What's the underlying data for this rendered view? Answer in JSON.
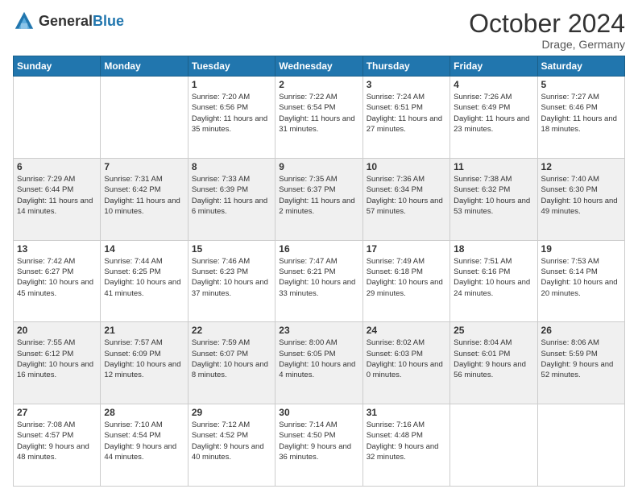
{
  "header": {
    "logo_general": "General",
    "logo_blue": "Blue",
    "month_title": "October 2024",
    "location": "Drage, Germany"
  },
  "days_of_week": [
    "Sunday",
    "Monday",
    "Tuesday",
    "Wednesday",
    "Thursday",
    "Friday",
    "Saturday"
  ],
  "weeks": [
    [
      {
        "day": "",
        "empty": true
      },
      {
        "day": "",
        "empty": true
      },
      {
        "day": "1",
        "sunrise": "Sunrise: 7:20 AM",
        "sunset": "Sunset: 6:56 PM",
        "daylight": "Daylight: 11 hours and 35 minutes."
      },
      {
        "day": "2",
        "sunrise": "Sunrise: 7:22 AM",
        "sunset": "Sunset: 6:54 PM",
        "daylight": "Daylight: 11 hours and 31 minutes."
      },
      {
        "day": "3",
        "sunrise": "Sunrise: 7:24 AM",
        "sunset": "Sunset: 6:51 PM",
        "daylight": "Daylight: 11 hours and 27 minutes."
      },
      {
        "day": "4",
        "sunrise": "Sunrise: 7:26 AM",
        "sunset": "Sunset: 6:49 PM",
        "daylight": "Daylight: 11 hours and 23 minutes."
      },
      {
        "day": "5",
        "sunrise": "Sunrise: 7:27 AM",
        "sunset": "Sunset: 6:46 PM",
        "daylight": "Daylight: 11 hours and 18 minutes."
      }
    ],
    [
      {
        "day": "6",
        "sunrise": "Sunrise: 7:29 AM",
        "sunset": "Sunset: 6:44 PM",
        "daylight": "Daylight: 11 hours and 14 minutes."
      },
      {
        "day": "7",
        "sunrise": "Sunrise: 7:31 AM",
        "sunset": "Sunset: 6:42 PM",
        "daylight": "Daylight: 11 hours and 10 minutes."
      },
      {
        "day": "8",
        "sunrise": "Sunrise: 7:33 AM",
        "sunset": "Sunset: 6:39 PM",
        "daylight": "Daylight: 11 hours and 6 minutes."
      },
      {
        "day": "9",
        "sunrise": "Sunrise: 7:35 AM",
        "sunset": "Sunset: 6:37 PM",
        "daylight": "Daylight: 11 hours and 2 minutes."
      },
      {
        "day": "10",
        "sunrise": "Sunrise: 7:36 AM",
        "sunset": "Sunset: 6:34 PM",
        "daylight": "Daylight: 10 hours and 57 minutes."
      },
      {
        "day": "11",
        "sunrise": "Sunrise: 7:38 AM",
        "sunset": "Sunset: 6:32 PM",
        "daylight": "Daylight: 10 hours and 53 minutes."
      },
      {
        "day": "12",
        "sunrise": "Sunrise: 7:40 AM",
        "sunset": "Sunset: 6:30 PM",
        "daylight": "Daylight: 10 hours and 49 minutes."
      }
    ],
    [
      {
        "day": "13",
        "sunrise": "Sunrise: 7:42 AM",
        "sunset": "Sunset: 6:27 PM",
        "daylight": "Daylight: 10 hours and 45 minutes."
      },
      {
        "day": "14",
        "sunrise": "Sunrise: 7:44 AM",
        "sunset": "Sunset: 6:25 PM",
        "daylight": "Daylight: 10 hours and 41 minutes."
      },
      {
        "day": "15",
        "sunrise": "Sunrise: 7:46 AM",
        "sunset": "Sunset: 6:23 PM",
        "daylight": "Daylight: 10 hours and 37 minutes."
      },
      {
        "day": "16",
        "sunrise": "Sunrise: 7:47 AM",
        "sunset": "Sunset: 6:21 PM",
        "daylight": "Daylight: 10 hours and 33 minutes."
      },
      {
        "day": "17",
        "sunrise": "Sunrise: 7:49 AM",
        "sunset": "Sunset: 6:18 PM",
        "daylight": "Daylight: 10 hours and 29 minutes."
      },
      {
        "day": "18",
        "sunrise": "Sunrise: 7:51 AM",
        "sunset": "Sunset: 6:16 PM",
        "daylight": "Daylight: 10 hours and 24 minutes."
      },
      {
        "day": "19",
        "sunrise": "Sunrise: 7:53 AM",
        "sunset": "Sunset: 6:14 PM",
        "daylight": "Daylight: 10 hours and 20 minutes."
      }
    ],
    [
      {
        "day": "20",
        "sunrise": "Sunrise: 7:55 AM",
        "sunset": "Sunset: 6:12 PM",
        "daylight": "Daylight: 10 hours and 16 minutes."
      },
      {
        "day": "21",
        "sunrise": "Sunrise: 7:57 AM",
        "sunset": "Sunset: 6:09 PM",
        "daylight": "Daylight: 10 hours and 12 minutes."
      },
      {
        "day": "22",
        "sunrise": "Sunrise: 7:59 AM",
        "sunset": "Sunset: 6:07 PM",
        "daylight": "Daylight: 10 hours and 8 minutes."
      },
      {
        "day": "23",
        "sunrise": "Sunrise: 8:00 AM",
        "sunset": "Sunset: 6:05 PM",
        "daylight": "Daylight: 10 hours and 4 minutes."
      },
      {
        "day": "24",
        "sunrise": "Sunrise: 8:02 AM",
        "sunset": "Sunset: 6:03 PM",
        "daylight": "Daylight: 10 hours and 0 minutes."
      },
      {
        "day": "25",
        "sunrise": "Sunrise: 8:04 AM",
        "sunset": "Sunset: 6:01 PM",
        "daylight": "Daylight: 9 hours and 56 minutes."
      },
      {
        "day": "26",
        "sunrise": "Sunrise: 8:06 AM",
        "sunset": "Sunset: 5:59 PM",
        "daylight": "Daylight: 9 hours and 52 minutes."
      }
    ],
    [
      {
        "day": "27",
        "sunrise": "Sunrise: 7:08 AM",
        "sunset": "Sunset: 4:57 PM",
        "daylight": "Daylight: 9 hours and 48 minutes."
      },
      {
        "day": "28",
        "sunrise": "Sunrise: 7:10 AM",
        "sunset": "Sunset: 4:54 PM",
        "daylight": "Daylight: 9 hours and 44 minutes."
      },
      {
        "day": "29",
        "sunrise": "Sunrise: 7:12 AM",
        "sunset": "Sunset: 4:52 PM",
        "daylight": "Daylight: 9 hours and 40 minutes."
      },
      {
        "day": "30",
        "sunrise": "Sunrise: 7:14 AM",
        "sunset": "Sunset: 4:50 PM",
        "daylight": "Daylight: 9 hours and 36 minutes."
      },
      {
        "day": "31",
        "sunrise": "Sunrise: 7:16 AM",
        "sunset": "Sunset: 4:48 PM",
        "daylight": "Daylight: 9 hours and 32 minutes."
      },
      {
        "day": "",
        "empty": true
      },
      {
        "day": "",
        "empty": true
      }
    ]
  ]
}
